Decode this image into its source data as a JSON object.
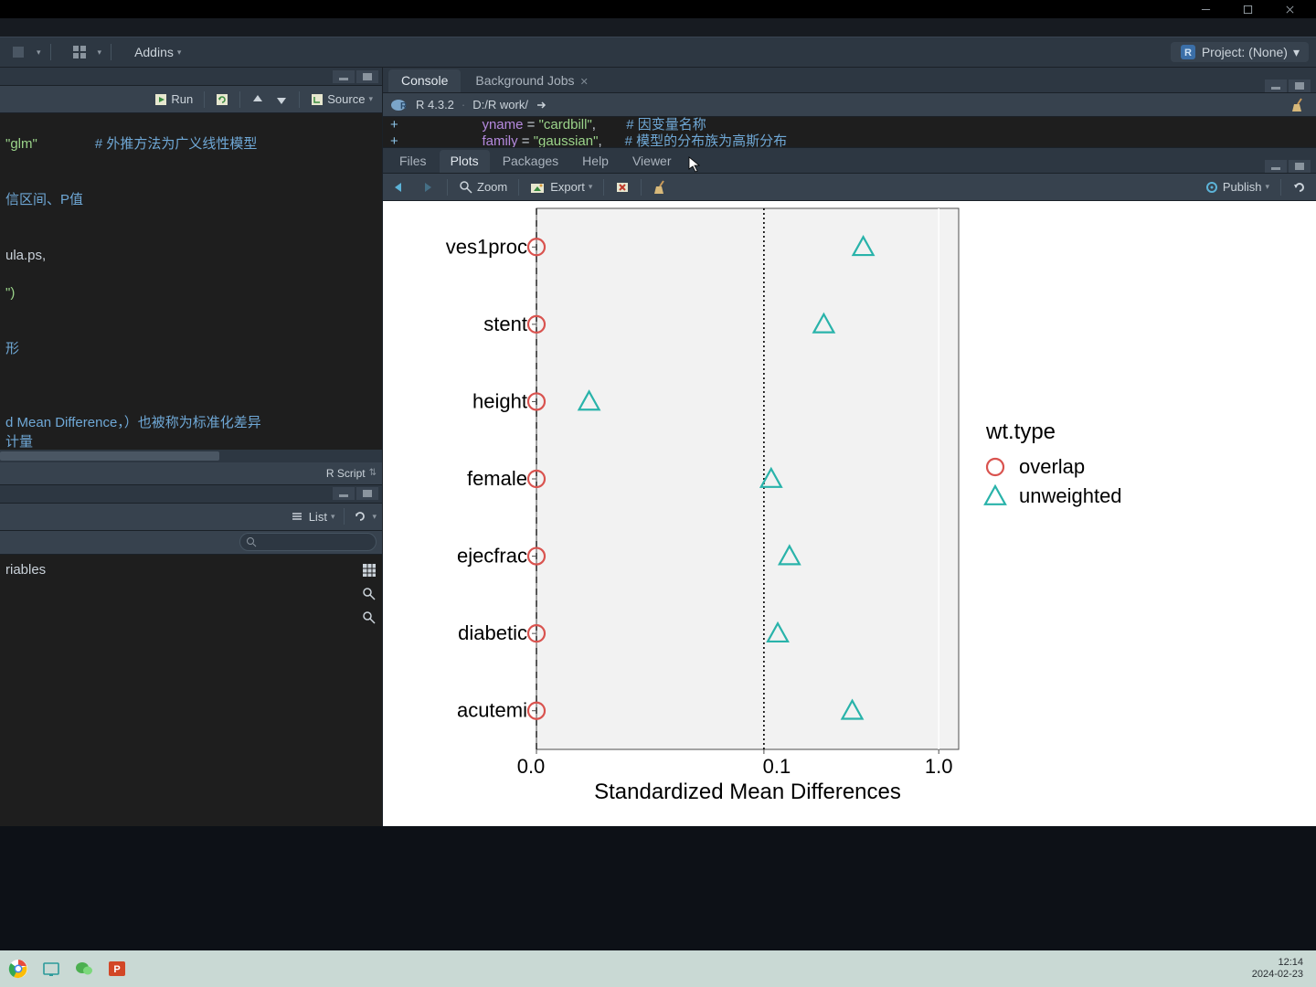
{
  "window": {
    "minimize": "—",
    "maximize": "▢",
    "close": "✕"
  },
  "toolbar": {
    "addins": "Addins",
    "project": "Project: (None)"
  },
  "source": {
    "run": "Run",
    "source": "Source",
    "code_line1_str": "\"glm\"",
    "code_line1_cmt": "# 外推方法为广义线性模型",
    "code_line2_cmt": "信区间、P值",
    "code_line3": "ula.ps,",
    "code_line4": "\")",
    "code_line5_cmt": "形",
    "code_line6_cmt": "d Mean Difference，）也被称为标准化差异",
    "code_line7_cmt": "计量",
    "footer": "R Script"
  },
  "env": {
    "list": "List",
    "var_label": "riables"
  },
  "console": {
    "tab_console": "Console",
    "tab_bgjobs": "Background Jobs",
    "r_version": "R 4.3.2",
    "wd": "D:/R work/",
    "line1_pre": "+                      ",
    "line1_kw1": "yname",
    "line1_eq": " = ",
    "line1_str1": "\"cardbill\"",
    "line1_comma": ",        ",
    "line1_cmt": "# 因变量名称",
    "line2_pre": "+                      ",
    "line2_kw1": "family",
    "line2_eq": " = ",
    "line2_str1": "\"gaussian\"",
    "line2_comma": ",      ",
    "line2_cmt": "# 模型的分布族为高斯分布"
  },
  "bottom_tabs": {
    "files": "Files",
    "plots": "Plots",
    "packages": "Packages",
    "help": "Help",
    "viewer": "Viewer"
  },
  "plot_tb": {
    "zoom": "Zoom",
    "export": "Export",
    "publish": "Publish"
  },
  "chart_data": {
    "type": "scatter",
    "xlabel": "Standardized Mean Differences",
    "xscale": "log10",
    "xlim": [
      0.005,
      1.3
    ],
    "xticks": [
      0.0,
      0.1,
      1.0
    ],
    "xtick_labels": [
      "0.0",
      "0.1",
      "1.0"
    ],
    "vlines": [
      0.0,
      0.1
    ],
    "categories": [
      "ves1proc",
      "stent",
      "height",
      "female",
      "ejecfrac",
      "diabetic",
      "acutemi"
    ],
    "legend_title": "wt.type",
    "series": [
      {
        "name": "overlap",
        "marker": "circle",
        "color": "#d9534f",
        "values": [
          0.005,
          0.005,
          0.005,
          0.005,
          0.005,
          0.005,
          0.005
        ]
      },
      {
        "name": "unweighted",
        "marker": "triangle",
        "color": "#29b3aa",
        "values": [
          0.37,
          0.22,
          0.01,
          0.11,
          0.14,
          0.12,
          0.32
        ]
      }
    ]
  },
  "taskbar": {
    "time": "12:14",
    "date": "2024-02-23"
  }
}
